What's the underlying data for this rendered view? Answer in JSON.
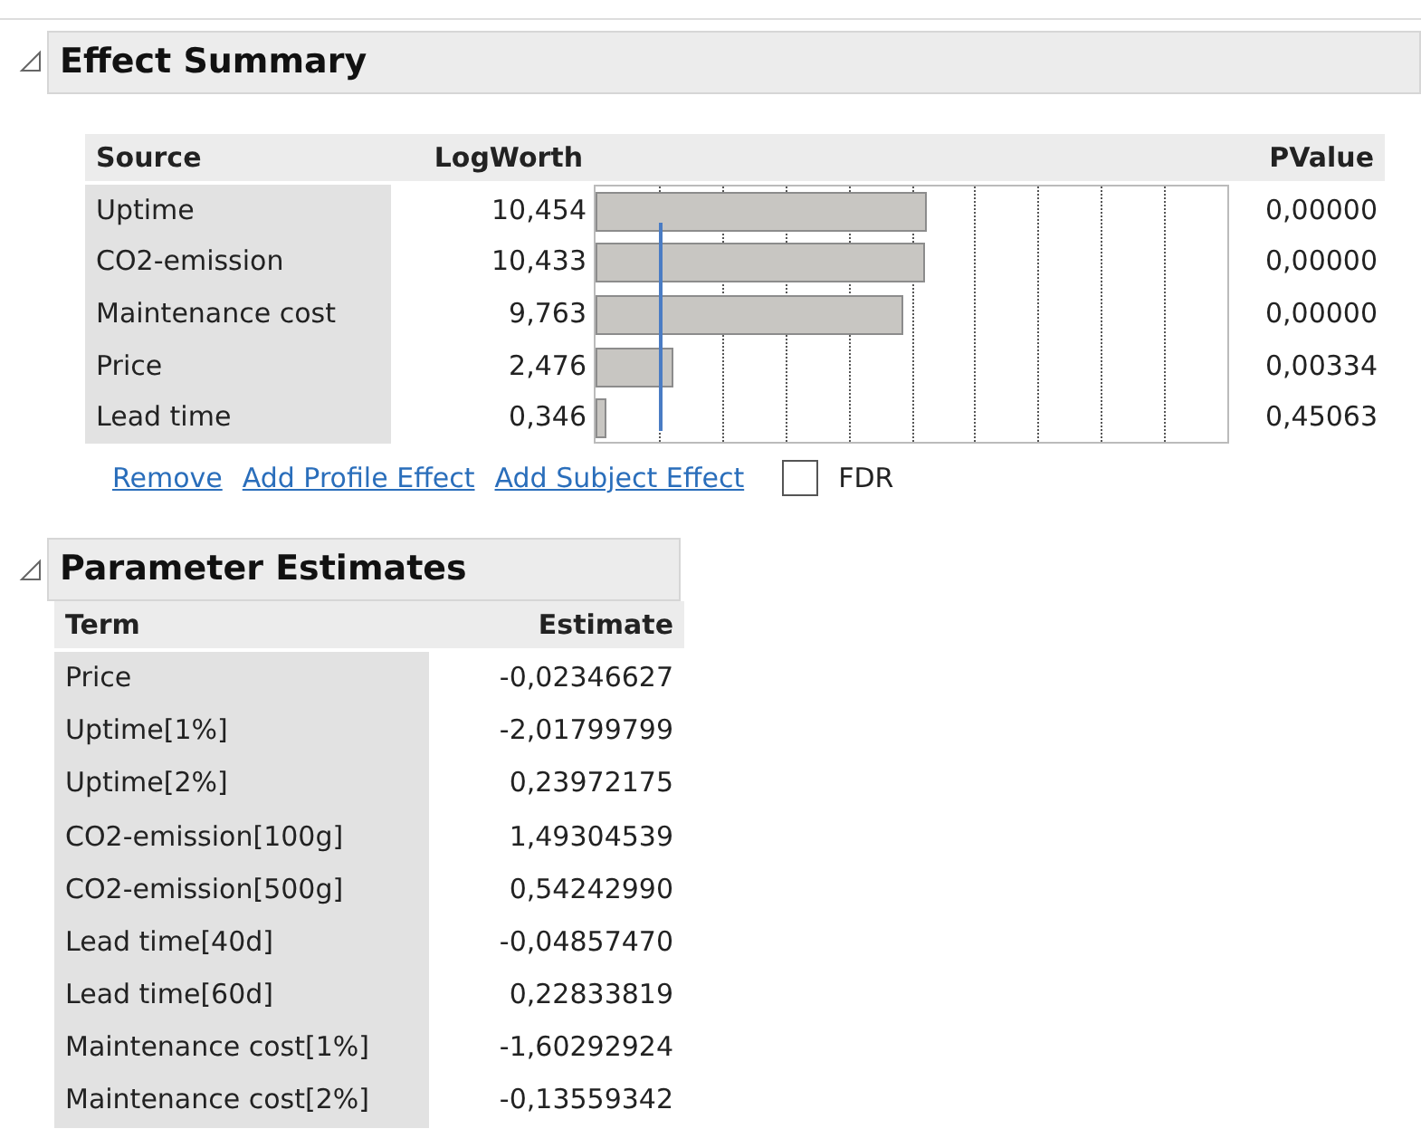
{
  "effect_summary": {
    "title": "Effect Summary",
    "expanded": true,
    "columns": [
      "Source",
      "LogWorth",
      "PValue"
    ],
    "rows": [
      {
        "source": "Uptime",
        "logworth": "10,454",
        "level": 0.523,
        "pvalue": "0,00000"
      },
      {
        "source": "CO2-emission",
        "logworth": "10,433",
        "level": 0.522,
        "pvalue": "0,00000"
      },
      {
        "source": "Maintenance cost",
        "logworth": "9,763",
        "level": 0.488,
        "pvalue": "0,00000"
      },
      {
        "source": "Price",
        "logworth": "2,476",
        "level": 0.124,
        "pvalue": "0,00334"
      },
      {
        "source": "Lead time",
        "logworth": "0,346",
        "level": 0.017,
        "pvalue": "0,45063"
      }
    ],
    "links": [
      "Remove",
      "Add Profile Effect",
      "Add Subject Effect"
    ],
    "fdr": {
      "label": "FDR",
      "checked": false
    }
  },
  "parameter_estimates": {
    "title": "Parameter Estimates",
    "expanded": true,
    "columns": [
      "Term",
      "Estimate"
    ],
    "rows": [
      {
        "term": "Price",
        "estimate": "-0,02346627"
      },
      {
        "term": "Uptime[1%]",
        "estimate": "-2,01799799"
      },
      {
        "term": "Uptime[2%]",
        "estimate": "0,23972175"
      },
      {
        "term": "CO2-emission[100g]",
        "estimate": "1,49304539"
      },
      {
        "term": "CO2-emission[500g]",
        "estimate": "0,54242990"
      },
      {
        "term": "Lead time[40d]",
        "estimate": "-0,04857470"
      },
      {
        "term": "Lead time[60d]",
        "estimate": "0,22833819"
      },
      {
        "term": "Maintenance cost[1%]",
        "estimate": "-1,60292924"
      },
      {
        "term": "Maintenance cost[2%]",
        "estimate": "-0,13559342"
      }
    ]
  }
}
